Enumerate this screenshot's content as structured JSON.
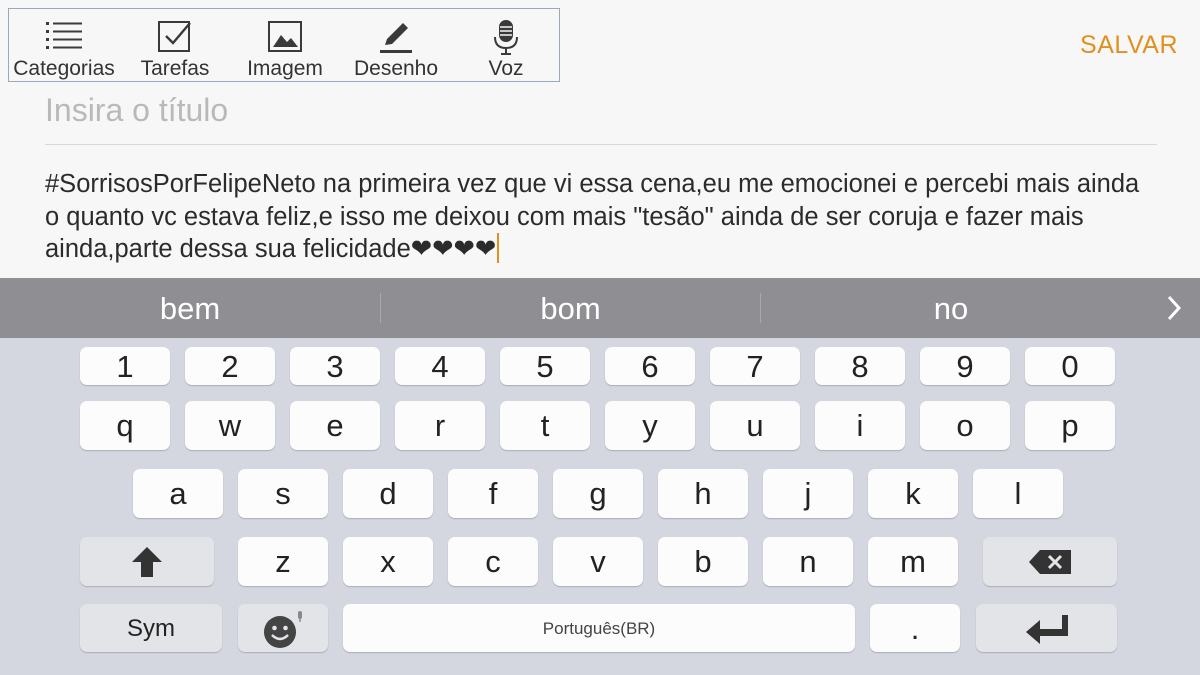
{
  "toolbar": {
    "items": [
      {
        "label": "Categorias",
        "icon": "list-icon"
      },
      {
        "label": "Tarefas",
        "icon": "checkbox-icon"
      },
      {
        "label": "Imagem",
        "icon": "image-icon"
      },
      {
        "label": "Desenho",
        "icon": "pencil-icon"
      },
      {
        "label": "Voz",
        "icon": "microphone-icon"
      }
    ],
    "save_label": "SALVAR"
  },
  "note": {
    "title_placeholder": "Insira o título",
    "body": "#SorrisosPorFelipeNeto na primeira vez que vi essa cena,eu me emocionei e percebi mais ainda o quanto vc estava feliz,e isso me deixou com mais \"tesão\" ainda de ser coruja e fazer mais ainda,parte dessa sua felicidade❤❤❤❤"
  },
  "suggestions": {
    "words": [
      "bem",
      "bom",
      "no"
    ],
    "more_icon": "chevron-right-icon"
  },
  "keyboard": {
    "numbers": [
      "1",
      "2",
      "3",
      "4",
      "5",
      "6",
      "7",
      "8",
      "9",
      "0"
    ],
    "row1": [
      "q",
      "w",
      "e",
      "r",
      "t",
      "y",
      "u",
      "i",
      "o",
      "p"
    ],
    "row2": [
      "a",
      "s",
      "d",
      "f",
      "g",
      "h",
      "j",
      "k",
      "l"
    ],
    "row3": [
      "z",
      "x",
      "c",
      "v",
      "b",
      "n",
      "m"
    ],
    "sym_label": "Sym",
    "space_label": "Português(BR)",
    "period_label": ".",
    "shift_icon": "shift-arrow-icon",
    "backspace_icon": "backspace-icon",
    "enter_icon": "enter-icon",
    "emoji_icon": "emoji-icon"
  },
  "colors": {
    "accent": "#e0901e",
    "suggestion_bar": "#8e8e93",
    "keyboard_bg": "#d4d7df"
  }
}
